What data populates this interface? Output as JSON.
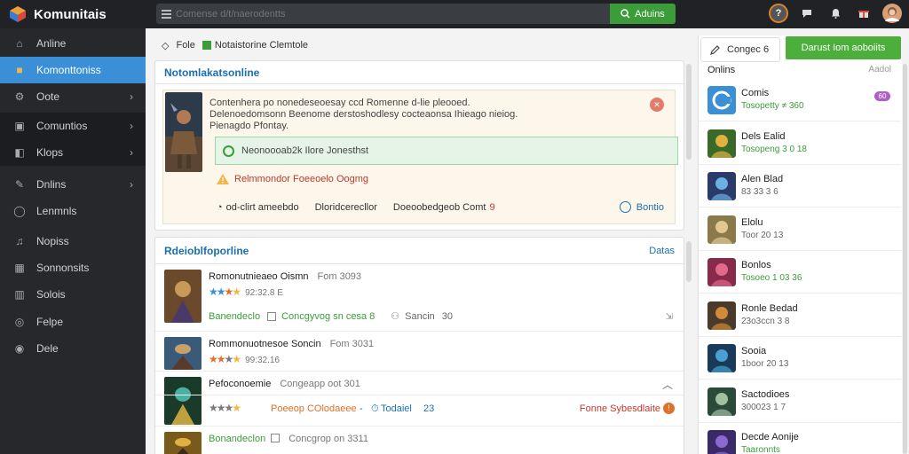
{
  "app": {
    "title": "Komunitais"
  },
  "search": {
    "placeholder": "Comense d/t/naerodentts",
    "button_label": "Aduins"
  },
  "sidebar": {
    "items": [
      {
        "label": "Anline",
        "icon": "home-icon",
        "chevron": false,
        "state": "normal"
      },
      {
        "label": "Komonttoniss",
        "icon": "community-icon",
        "chevron": false,
        "state": "active"
      },
      {
        "label": "Oote",
        "icon": "settings-icon",
        "chevron": true,
        "state": "normal"
      },
      {
        "label": "Comuntios",
        "icon": "chat-icon",
        "chevron": true,
        "state": "dark"
      },
      {
        "label": "Klops",
        "icon": "tag-icon",
        "chevron": true,
        "state": "dark"
      },
      {
        "label": "Dnlins",
        "icon": "edit-icon",
        "chevron": true,
        "state": "normal"
      },
      {
        "label": "Lenmnls",
        "icon": "globe-icon",
        "chevron": false,
        "state": "normal"
      },
      {
        "label": "Nopiss",
        "icon": "bell-icon",
        "chevron": false,
        "state": "normal"
      },
      {
        "label": "Sonnonsits",
        "icon": "grid-icon",
        "chevron": false,
        "state": "normal"
      },
      {
        "label": "Solois",
        "icon": "chart-icon",
        "chevron": false,
        "state": "normal"
      },
      {
        "label": "Felpe",
        "icon": "help-icon",
        "chevron": false,
        "state": "normal"
      },
      {
        "label": "Dele",
        "icon": "info-icon",
        "chevron": false,
        "state": "normal"
      }
    ]
  },
  "breadcrumb": {
    "first": "Fole",
    "second": "Notaistorine Clemtole"
  },
  "featured": {
    "title": "Notomlakatsonline",
    "desc_1": "Contenhera po nonedeseoesay ccd Romenne d-lie pleooed.",
    "desc_2": "Delenoedomsonn Beenome derstoshodlesy cocteaonsa Ihieago nieiog.",
    "desc_3": "Pienagdo Pfontay.",
    "notice": "Neonoooab2k Ilore Jonesthst",
    "warning": "Relmmondor Foeeoelo Oogmg",
    "meta_1": "od-clirt ameebdo",
    "meta_2": "Dloridcerecllor",
    "meta_3": "Doeoobedgeob Comt",
    "meta_3_num": "9",
    "link": "Bontio"
  },
  "list_panel": {
    "title": "Rdeioblfoporline",
    "more": "Datas",
    "rows": [
      {
        "title": "Romonutnieaeo Oismn",
        "sub": "Fom 3093",
        "score": "92:32.8 E",
        "action_1": "Banendeclo",
        "action_2": "Concgyvog sn cesa 8",
        "action_3": "Sancin",
        "action_3_num": "30"
      },
      {
        "title": "Rommonuotnesoe Soncin",
        "sub": "Fom 3031",
        "score": "99:32.16",
        "action_1": "",
        "action_2": "",
        "action_3": "",
        "action_3_num": ""
      },
      {
        "title": "Pefoconoemie",
        "sub": "Congeapp oot 301",
        "score": "",
        "action_1": "Poeeop COlodaeee",
        "action_2": "Todaiel",
        "action_3": "Fonne Sybesdlaite",
        "action_3_num": "23"
      },
      {
        "title": "Bonandeclon",
        "sub": "Concgrop on 3311",
        "score": "",
        "action_1": "",
        "action_2": "",
        "action_3": "",
        "action_3_num": ""
      }
    ]
  },
  "right": {
    "tab_label": "Congec 6",
    "button_label": "Darust Iom aoboiits",
    "header": "Onlins",
    "header_right": "Aadol",
    "friends": [
      {
        "name": "Comis",
        "status": "Tosopetty ≠ 360",
        "online": true,
        "badge": "60"
      },
      {
        "name": "Dels Ealid",
        "status": "Tosopeng 3 0 18",
        "online": true,
        "badge": ""
      },
      {
        "name": "Alen Blad",
        "status": "83 33 3 6",
        "online": false,
        "badge": ""
      },
      {
        "name": "Elolu",
        "status": "Toor 20 13",
        "online": false,
        "badge": ""
      },
      {
        "name": "Bonlos",
        "status": "Tosoeo 1 03 36",
        "online": true,
        "badge": ""
      },
      {
        "name": "Ronle Bedad",
        "status": "23o3ccn 3 8",
        "online": false,
        "badge": ""
      },
      {
        "name": "Sooia",
        "status": "1boor 20 13",
        "online": false,
        "badge": ""
      },
      {
        "name": "Sactodioes",
        "status": "300023 1 7",
        "online": false,
        "badge": ""
      },
      {
        "name": "Decde Aonije",
        "status": "Taaronnts",
        "online": true,
        "badge": ""
      }
    ]
  }
}
